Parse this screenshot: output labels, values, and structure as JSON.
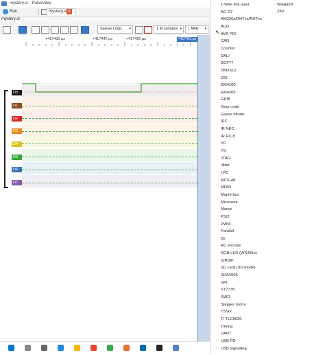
{
  "window": {
    "title": "mystery.sr - PulseView"
  },
  "toolbar": {
    "run_label": "Run"
  },
  "tab": {
    "label": "mystery.sr",
    "close_glyph": "×"
  },
  "file_bar": {
    "label": "mystery.sr"
  },
  "device": {
    "value": "Saleae Logic"
  },
  "samples": {
    "value": "1 M samples"
  },
  "rate": {
    "value": "1 MHz"
  },
  "ruler": {
    "labels": [
      "+417430 µs",
      "+417440 µs",
      "+417450 µs"
    ],
    "cursor_label": "+417461 µs"
  },
  "channels": [
    "D0",
    "D1",
    "D2",
    "D3",
    "D4",
    "D5",
    "D6",
    "D7"
  ],
  "channel_colors": [
    "#1a1a1a",
    "#8a4b1e",
    "#d42a2a",
    "#ea8a1a",
    "#d9c21a",
    "#3aa63a",
    "#3a72b8",
    "#8a5aa8"
  ],
  "decoder_menu": {
    "column2": [
      "Wiegand",
      "Z80"
    ],
    "items": [
      "1-Wire link layer",
      "AC '97",
      "AM230x/DHTxx/RHTxx",
      "AUD",
      "AVR PDI",
      "CAN",
      "Counter",
      "DALI",
      "DCF77",
      "DMX512",
      "DSI",
      "EM4100",
      "EM4305",
      "GPIB",
      "Gray code",
      "Guess bitrate",
      "IEC",
      "IR NEC",
      "IR RC-5",
      "I²C",
      "I²S",
      "JTAG",
      "Jitter",
      "LPC",
      "MCS-48",
      "MDIO",
      "Maple bus",
      "Microwire",
      "Morse",
      "PS/2",
      "PWM",
      "Parallel",
      "Qi",
      "RC encode",
      "RGB LED (WS281x)",
      "S/PDIF",
      "SD card (SD mode)",
      "SDA2506",
      "SPI",
      "ST7735",
      "SWD",
      "Stepper motor",
      "T55xx",
      "TI TLC5620",
      "Timing",
      "UART",
      "USB PD",
      "USB signalling"
    ]
  }
}
